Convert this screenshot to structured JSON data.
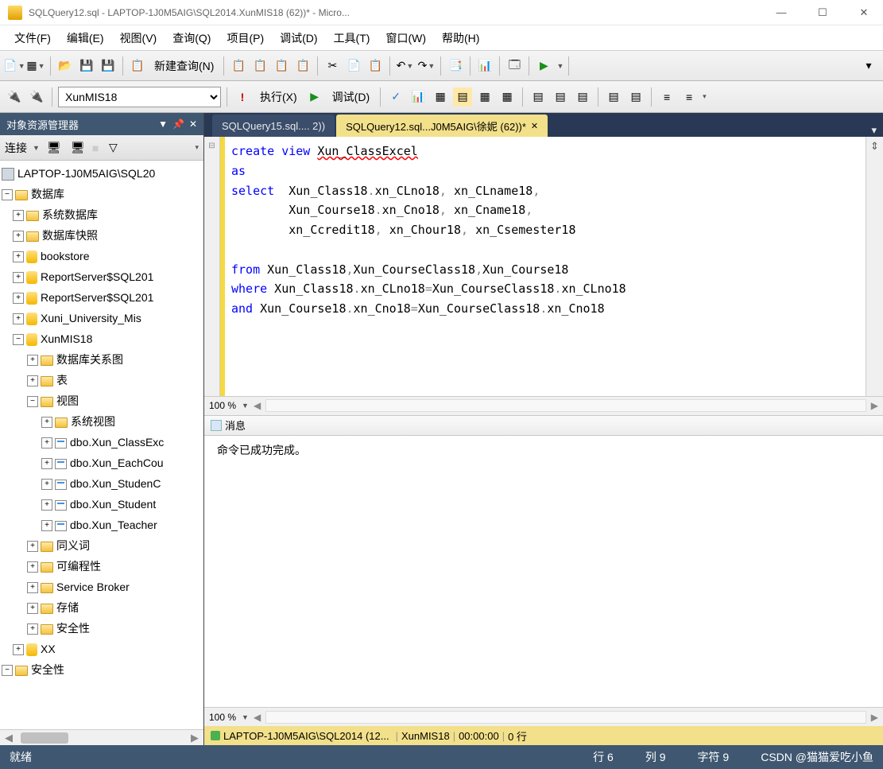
{
  "title": "SQLQuery12.sql - LAPTOP-1J0M5AIG\\SQL2014.XunMIS18                                (62))* - Micro...",
  "menu": [
    "文件(F)",
    "编辑(E)",
    "视图(V)",
    "查询(Q)",
    "项目(P)",
    "调试(D)",
    "工具(T)",
    "窗口(W)",
    "帮助(H)"
  ],
  "toolbar": {
    "new_query": "新建查询(N)"
  },
  "toolbar2": {
    "db": "XunMIS18",
    "execute": "执行(X)",
    "debug": "调试(D)"
  },
  "sidebar": {
    "title": "对象资源管理器",
    "connect": "连接",
    "server": "LAPTOP-1J0M5AIG\\SQL20",
    "nodes": {
      "databases": "数据库",
      "sysdb": "系统数据库",
      "snapshot": "数据库快照",
      "bookstore": "bookstore",
      "rs1": "ReportServer$SQL201",
      "rs2": "ReportServer$SQL201",
      "xuni": "Xuni_University_Mis",
      "xunmis": "XunMIS18",
      "diagram": "数据库关系图",
      "tables": "表",
      "views": "视图",
      "sysviews": "系统视图",
      "v1": "dbo.Xun_ClassExc",
      "v2": "dbo.Xun_EachCou",
      "v3": "dbo.Xun_StudenC",
      "v4": "dbo.Xun_Student",
      "v5": "dbo.Xun_Teacher",
      "synonyms": "同义词",
      "prog": "可编程性",
      "sb": "Service Broker",
      "storage": "存储",
      "security": "安全性",
      "xx": "XX",
      "security2": "安全性"
    }
  },
  "tabs": {
    "t1": "SQLQuery15.sql....                    2))",
    "t2": "SQLQuery12.sql...J0M5AIG\\徐妮 (62))*"
  },
  "code": {
    "l1a": "create",
    "l1b": "view",
    "l1c": "Xun_ClassExcel",
    "l2": "as",
    "l3a": "select",
    "l3b": "  Xun_Class18",
    "l3c": "xn_CLno18",
    "l3d": "xn_CLname18",
    "l4a": "        Xun_Course18",
    "l4b": "xn_Cno18",
    "l4c": "xn_Cname18",
    "l5a": "        xn_Ccredit18",
    "l5b": "xn_Chour18",
    "l5c": "xn_Csemester18",
    "l7a": "from",
    "l7b": " Xun_Class18",
    "l7c": "Xun_CourseClass18",
    "l7d": "Xun_Course18",
    "l8a": "where",
    "l8b": " Xun_Class18",
    "l8c": "xn_CLno18",
    "l8d": "Xun_CourseClass18",
    "l8e": "xn_CLno18",
    "l9a": "and",
    "l9b": " Xun_Course18",
    "l9c": "xn_Cno18",
    "l9d": "Xun_CourseClass18",
    "l9e": "xn_Cno18"
  },
  "zoom": "100 %",
  "messages": {
    "tab": "消息",
    "text": "命令已成功完成。"
  },
  "result_status": {
    "server": "LAPTOP-1J0M5AIG\\SQL2014 (12...",
    "blur": "                                  ",
    "db": "XunMIS18",
    "time": "00:00:00",
    "rows": "0 行"
  },
  "status": {
    "ready": "就绪",
    "line": "行 6",
    "col": "列 9",
    "char": "字符 9",
    "csdn": "CSDN @猫猫爱吃小鱼"
  }
}
